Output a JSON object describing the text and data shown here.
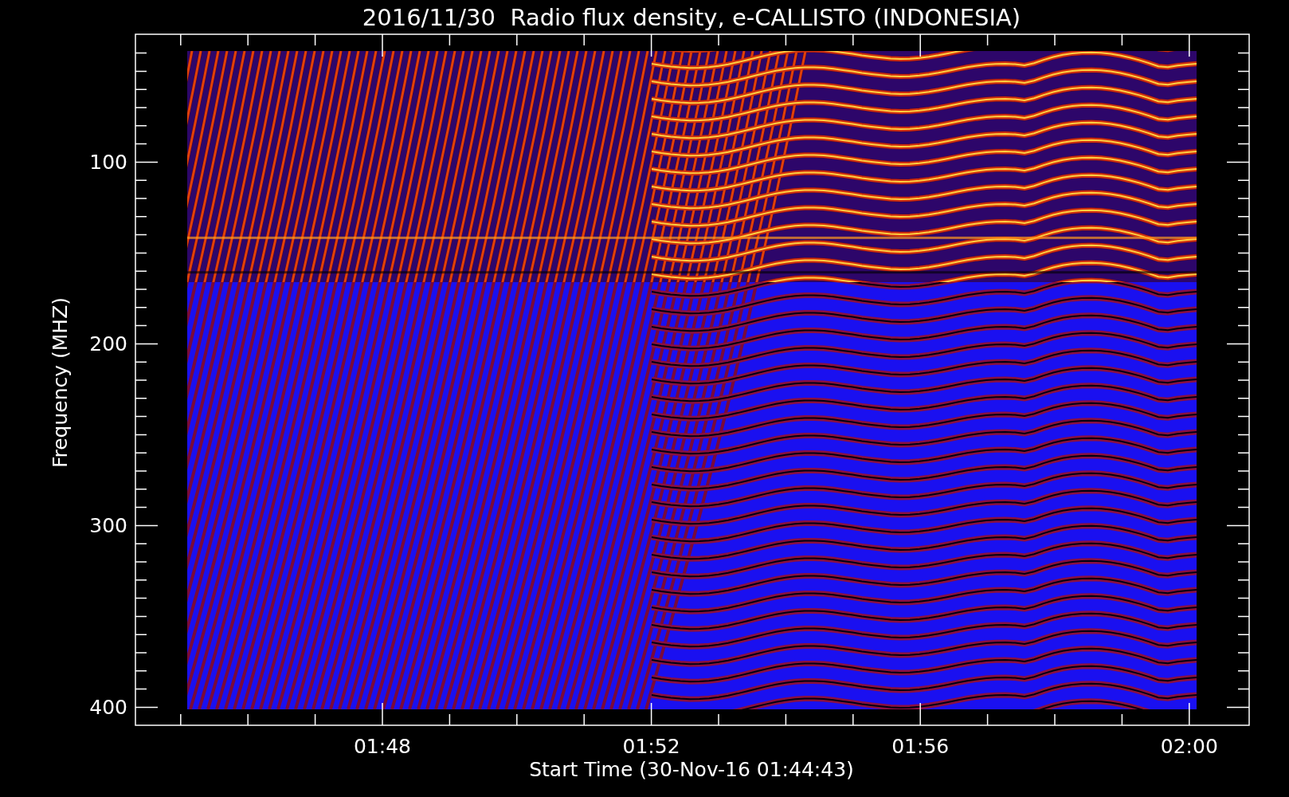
{
  "title": "2016/11/30  Radio flux density, e-CALLISTO (INDONESIA)",
  "plot": {
    "ylabel": "Frequency (MHZ)",
    "xlabel": "Start Time (30-Nov-16 01:44:43)",
    "yticks": [
      "100",
      "200",
      "300",
      "400"
    ],
    "xticks": [
      "01:48",
      "01:52",
      "01:56",
      "02:00"
    ]
  }
}
